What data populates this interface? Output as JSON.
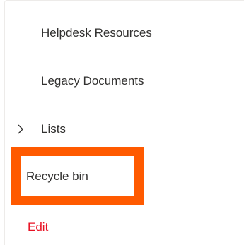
{
  "nav": {
    "items": [
      {
        "label": "Helpdesk Resources"
      },
      {
        "label": "Legacy Documents"
      },
      {
        "label": "Lists",
        "expandable": true,
        "chevron_icon": "chevron-right-icon"
      },
      {
        "label": "Recycle bin",
        "highlighted": true
      }
    ],
    "edit_label": "Edit"
  },
  "colors": {
    "highlight": "#ff5a00",
    "edit_link": "#e81123",
    "text": "#323130"
  }
}
